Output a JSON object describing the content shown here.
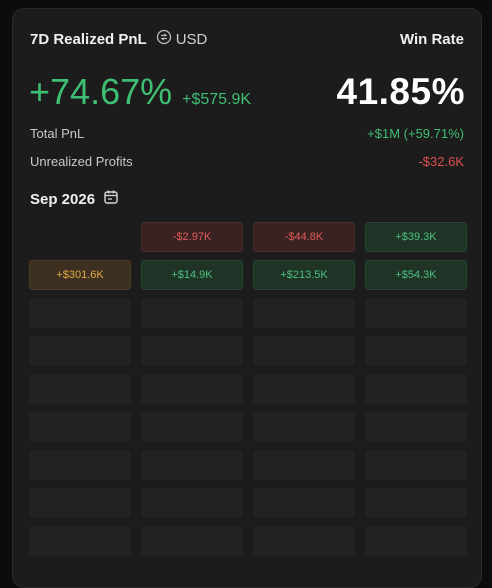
{
  "header": {
    "title": "7D Realized PnL",
    "currency_label": "USD",
    "currency_icon": "currency-swap-icon",
    "win_rate_label": "Win Rate"
  },
  "summary": {
    "realized_pct": "+74.67%",
    "realized_abs": "+$575.9K",
    "win_rate": "41.85%",
    "total_pnl_label": "Total PnL",
    "total_pnl_value": "+$1M (+59.71%)",
    "unrealized_label": "Unrealized Profits",
    "unrealized_value": "-$32.6K"
  },
  "calendar": {
    "month_label": "Sep 2026",
    "icon": "calendar-icon",
    "cells": [
      {
        "label": "",
        "kind": "blank"
      },
      {
        "label": "-$2.97K",
        "kind": "loss"
      },
      {
        "label": "-$44.8K",
        "kind": "loss"
      },
      {
        "label": "+$39.3K",
        "kind": "gain"
      },
      {
        "label": "+$301.6K",
        "kind": "gold"
      },
      {
        "label": "+$14.9K",
        "kind": "gain"
      },
      {
        "label": "+$213.5K",
        "kind": "gain"
      },
      {
        "label": "+$54.3K",
        "kind": "gain"
      },
      {
        "label": "",
        "kind": "empty"
      },
      {
        "label": "",
        "kind": "empty"
      },
      {
        "label": "",
        "kind": "empty"
      },
      {
        "label": "",
        "kind": "empty"
      },
      {
        "label": "",
        "kind": "empty"
      },
      {
        "label": "",
        "kind": "empty"
      },
      {
        "label": "",
        "kind": "empty"
      },
      {
        "label": "",
        "kind": "empty"
      },
      {
        "label": "",
        "kind": "empty"
      },
      {
        "label": "",
        "kind": "empty"
      },
      {
        "label": "",
        "kind": "empty"
      },
      {
        "label": "",
        "kind": "empty"
      },
      {
        "label": "",
        "kind": "empty"
      },
      {
        "label": "",
        "kind": "empty"
      },
      {
        "label": "",
        "kind": "empty"
      },
      {
        "label": "",
        "kind": "empty"
      },
      {
        "label": "",
        "kind": "empty"
      },
      {
        "label": "",
        "kind": "empty"
      },
      {
        "label": "",
        "kind": "empty"
      },
      {
        "label": "",
        "kind": "empty"
      },
      {
        "label": "",
        "kind": "empty"
      },
      {
        "label": "",
        "kind": "empty"
      },
      {
        "label": "",
        "kind": "empty"
      },
      {
        "label": "",
        "kind": "empty"
      },
      {
        "label": "",
        "kind": "empty"
      },
      {
        "label": "",
        "kind": "empty"
      },
      {
        "label": "",
        "kind": "empty"
      },
      {
        "label": "",
        "kind": "empty"
      }
    ]
  },
  "colors": {
    "positive": "#3fbf73",
    "negative": "#e0504f",
    "highlight": "#e0a948",
    "card_bg": "#1c1c1c"
  }
}
